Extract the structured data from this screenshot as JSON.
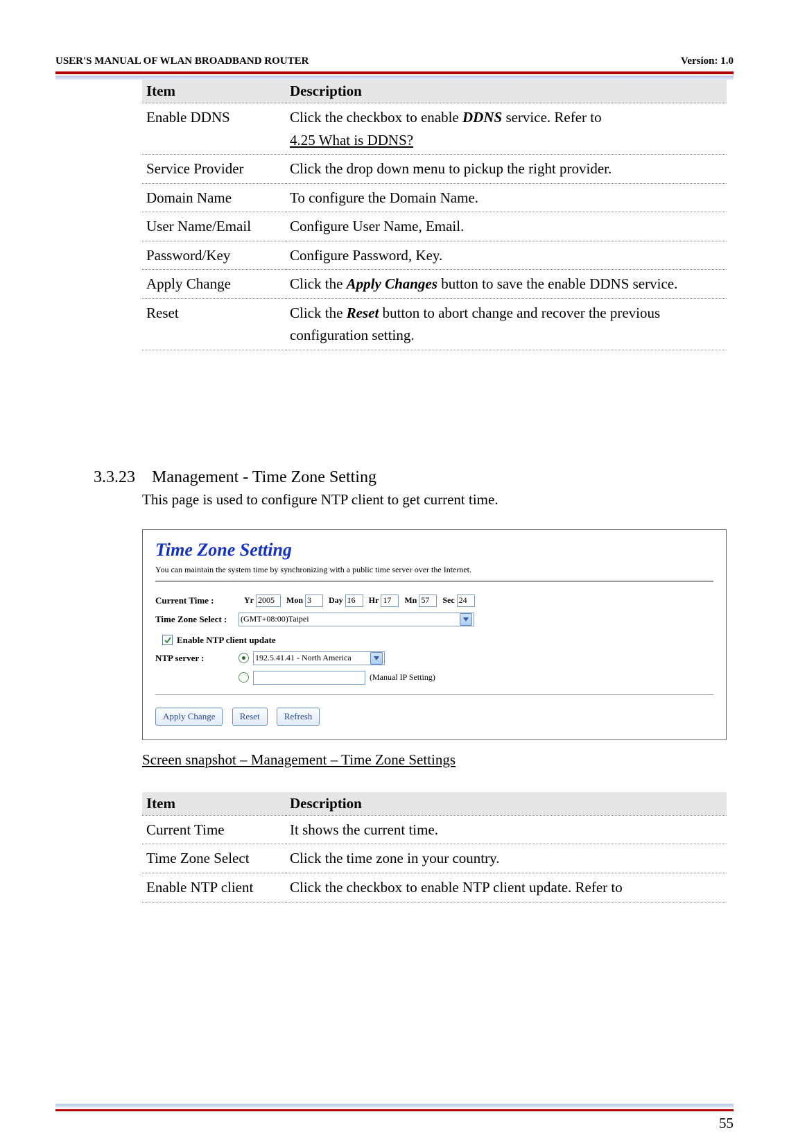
{
  "header": {
    "left": "USER'S MANUAL OF WLAN BROADBAND ROUTER",
    "right": "Version: 1.0"
  },
  "table1": {
    "head_item": "Item",
    "head_desc": "Description",
    "rows": {
      "r0_item": "Enable DDNS",
      "r0_desc_a": "Click the checkbox to enable ",
      "r0_desc_b": "DDNS",
      "r0_desc_c": " service. Refer to ",
      "r0_desc_link": "4.25 What is DDNS?",
      "r1_item": "Service Provider",
      "r1_desc": "Click the drop down menu to pickup the right provider.",
      "r2_item": "Domain Name",
      "r2_desc": "To configure the Domain Name.",
      "r3_item": "User Name/Email",
      "r3_desc": "Configure User Name, Email.",
      "r4_item": "Password/Key",
      "r4_desc": "Configure Password, Key.",
      "r5_item": "Apply Change",
      "r5_desc_a": "Click the ",
      "r5_desc_b": "Apply Changes",
      "r5_desc_c": " button to save the enable DDNS service.",
      "r6_item": "Reset",
      "r6_desc_a": "Click the ",
      "r6_desc_b": "Reset",
      "r6_desc_c": " button to abort change and recover the previous configuration setting."
    }
  },
  "section": {
    "number": "3.3.23",
    "title": "Management - Time Zone Setting",
    "desc": "This page is used to configure NTP client to get current time."
  },
  "screenshot": {
    "title": "Time Zone Setting",
    "sub": "You can maintain the system time by synchronizing with a public time server over the Internet.",
    "current_time_label": "Current Time :",
    "yr_label": "Yr",
    "yr_val": "2005",
    "mon_label": "Mon",
    "mon_val": "3",
    "day_label": "Day",
    "day_val": "16",
    "hr_label": "Hr",
    "hr_val": "17",
    "mn_label": "Mn",
    "mn_val": "57",
    "sec_label": "Sec",
    "sec_val": "24",
    "tz_label": "Time Zone Select :",
    "tz_val": "(GMT+08:00)Taipei",
    "enable_ntp": "Enable NTP client update",
    "ntp_label": "NTP server :",
    "ntp_val": "192.5.41.41 - North America",
    "manual_label": "(Manual IP Setting)",
    "btn_apply": "Apply Change",
    "btn_reset": "Reset",
    "btn_refresh": "Refresh"
  },
  "caption": "Screen snapshot – Management – Time Zone Settings",
  "table2": {
    "head_item": "Item",
    "head_desc": "Description",
    "rows": {
      "r0_item": "Current Time",
      "r0_desc": "It shows the current time.",
      "r1_item": "Time Zone Select",
      "r1_desc": "Click the time zone in your country.",
      "r2_item": "Enable NTP client",
      "r2_desc": "Click the checkbox to enable NTP client update. Refer to"
    }
  },
  "page_number": "55"
}
